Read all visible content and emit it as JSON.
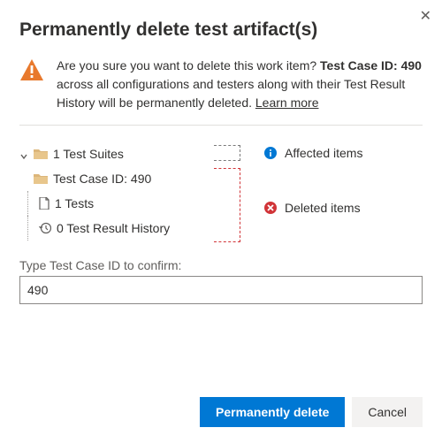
{
  "dialog": {
    "title": "Permanently delete test artifact(s)",
    "warning_prefix": "Are you sure you want to delete this work item? ",
    "warning_bold": "Test Case ID: 490",
    "warning_suffix": " across all configurations and testers along with their Test Result History will be permanently deleted. ",
    "learn_more": "Learn more"
  },
  "tree": {
    "suites": "1 Test Suites",
    "case": "Test Case ID: 490",
    "tests": "1 Tests",
    "history": "0 Test Result History"
  },
  "legend": {
    "affected": "Affected items",
    "deleted": "Deleted items"
  },
  "confirm": {
    "label": "Type Test Case ID to confirm:",
    "value": "490"
  },
  "buttons": {
    "primary": "Permanently delete",
    "secondary": "Cancel"
  }
}
